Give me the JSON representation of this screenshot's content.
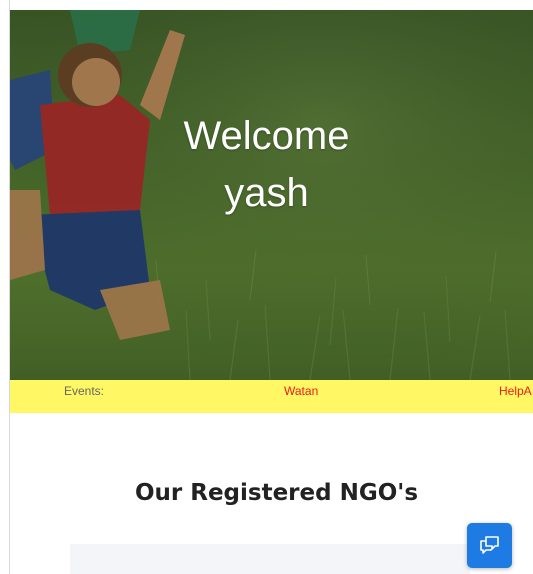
{
  "hero": {
    "welcome_text": "Welcome",
    "user_name": "yash"
  },
  "ticker": {
    "label": "Events:",
    "items": [
      "Watan",
      "HelpA"
    ]
  },
  "section": {
    "title": "Our Registered NGO's"
  },
  "chat": {
    "icon": "chat-icon",
    "color": "#1e7be3"
  },
  "colors": {
    "ticker_background": "#fff763",
    "ticker_item": "#ee1c1c"
  }
}
